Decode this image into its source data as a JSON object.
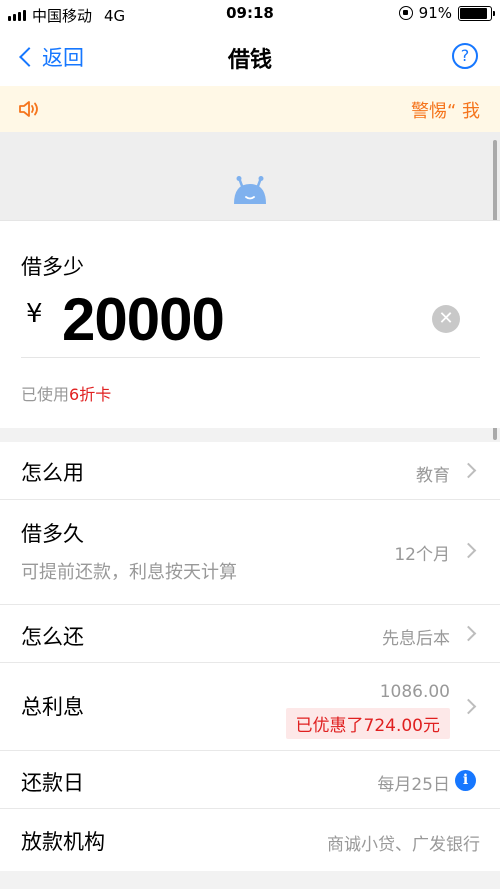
{
  "status_bar": {
    "carrier": "中国移动",
    "network": "4G",
    "time": "09:18",
    "battery": "91%"
  },
  "nav": {
    "back_label": "返回",
    "title": "借钱",
    "help_glyph": "?"
  },
  "notice": {
    "text": "警惕“ 我"
  },
  "amount": {
    "label": "借多少",
    "currency": "¥",
    "value": "20000",
    "coupon_prefix": "已使用",
    "coupon_highlight": "6折卡"
  },
  "rows": {
    "usage": {
      "label": "怎么用",
      "value": "教育"
    },
    "term": {
      "label": "借多久",
      "value": "12个月",
      "sub": "可提前还款，利息按天计算"
    },
    "repay": {
      "label": "怎么还",
      "value": "先息后本"
    },
    "interest": {
      "label": "总利息",
      "value": "1086.00",
      "discount": "已优惠了724.00元"
    },
    "repay_day": {
      "label": "还款日",
      "value": "每月25日"
    },
    "lender": {
      "label": "放款机构",
      "value": "商诚小贷、广发银行"
    }
  },
  "colors": {
    "accent": "#1677ff",
    "warning": "#f5751d",
    "discount": "#e02020"
  },
  "icons": [
    "signal-icon",
    "rotation-lock-icon",
    "battery-icon",
    "back-chevron-icon",
    "help-icon",
    "speaker-icon",
    "mascot-icon",
    "clear-icon",
    "chevron-right-icon",
    "info-icon"
  ]
}
